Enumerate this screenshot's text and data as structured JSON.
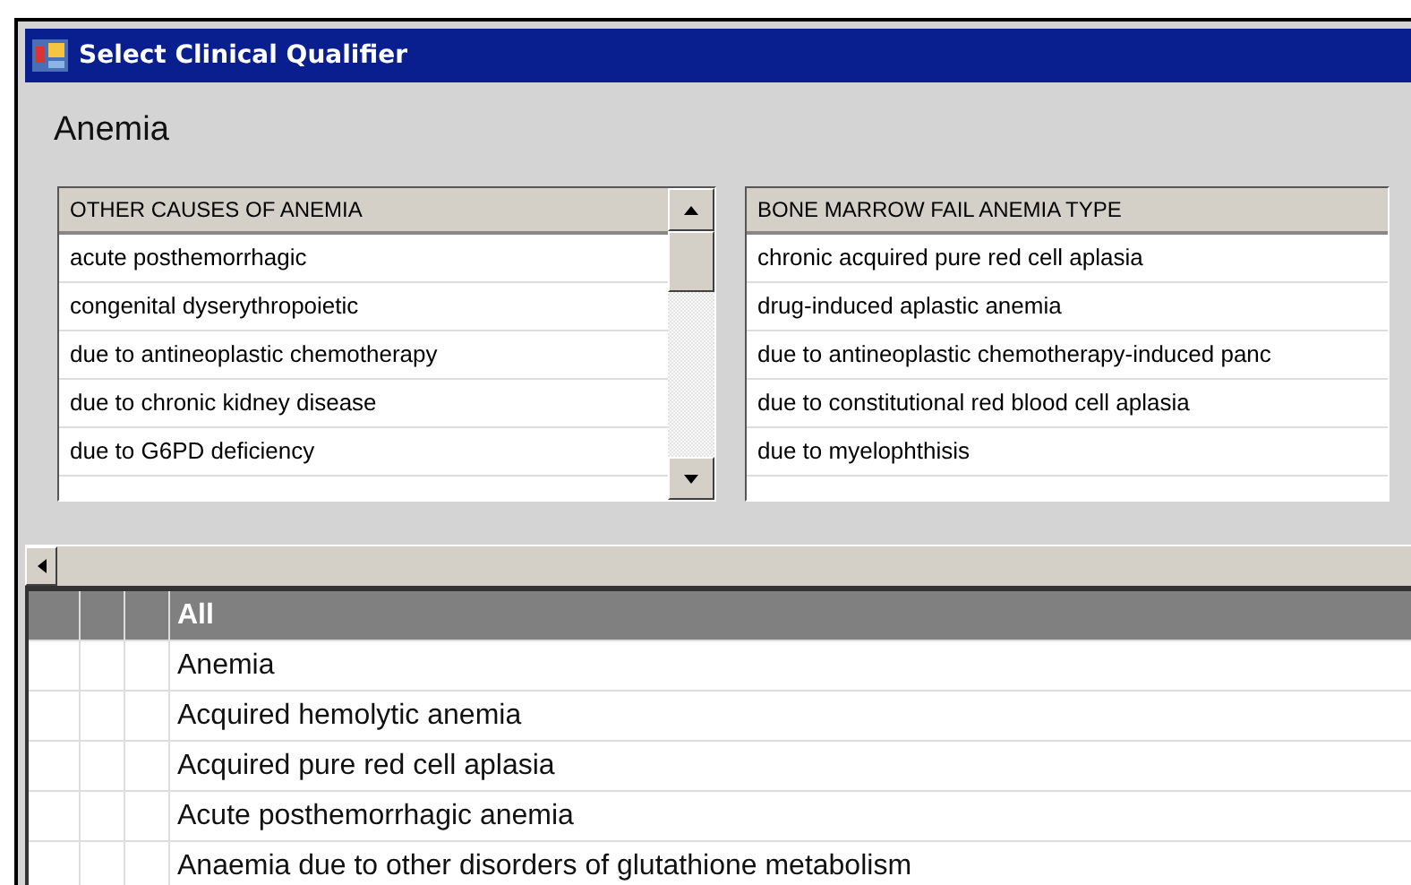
{
  "window": {
    "title": "Select Clinical Qualifier"
  },
  "heading": "Anemia",
  "lists": [
    {
      "header": "OTHER CAUSES OF ANEMIA",
      "scrollbar": true,
      "items": [
        "acute posthemorrhagic",
        "congenital dyserythropoietic",
        "due to antineoplastic chemotherapy",
        "due to chronic kidney disease",
        "due to G6PD deficiency"
      ]
    },
    {
      "header": "BONE MARROW FAIL ANEMIA TYPE",
      "scrollbar": false,
      "items": [
        "chronic acquired pure red cell aplasia",
        "drug-induced aplastic anemia",
        "due to antineoplastic chemotherapy-induced panc",
        "due to constitutional red blood cell aplasia",
        "due to myelophthisis"
      ]
    }
  ],
  "grid": {
    "rows": [
      {
        "label": "All",
        "selected": true
      },
      {
        "label": "Anemia",
        "selected": false
      },
      {
        "label": "Acquired hemolytic anemia",
        "selected": false
      },
      {
        "label": "Acquired pure red cell aplasia",
        "selected": false
      },
      {
        "label": "Acute posthemorrhagic anemia",
        "selected": false
      },
      {
        "label": "Anaemia due to other disorders of glutathione metabolism",
        "selected": false
      }
    ]
  }
}
